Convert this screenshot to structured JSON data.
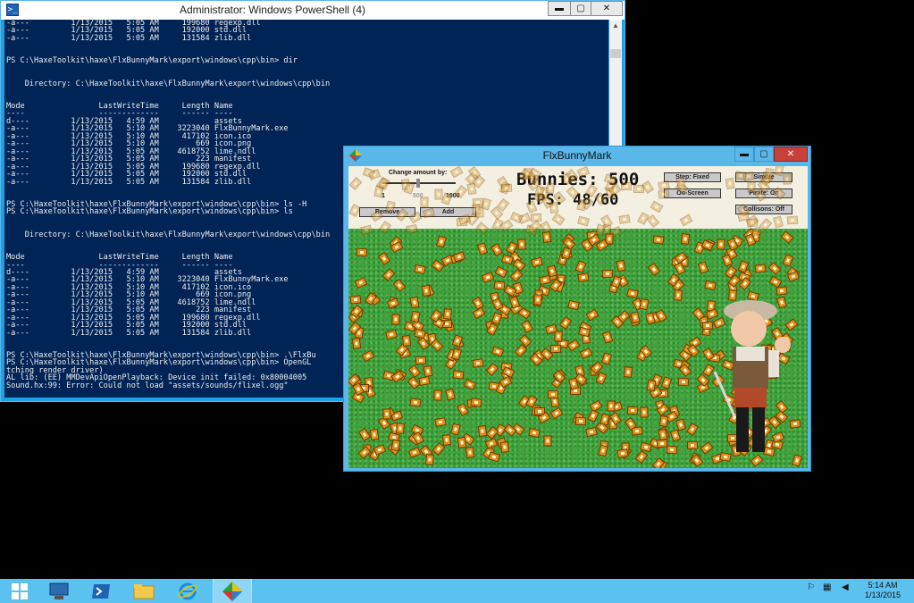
{
  "powershell": {
    "title": "Administrator: Windows PowerShell (4)",
    "min_label": "▬",
    "max_label": "▢",
    "close_label": "✕",
    "console_text": "-a---         1/13/2015   5:05 AM     199680 regexp.dll\n-a---         1/13/2015   5:05 AM     192000 std.dll\n-a---         1/13/2015   5:05 AM     131584 zlib.dll\n\n\nPS C:\\HaxeToolkit\\haxe\\FlxBunnyMark\\export\\windows\\cpp\\bin> dir\n\n\n    Directory: C:\\HaxeToolkit\\haxe\\FlxBunnyMark\\export\\windows\\cpp\\bin\n\n\nMode                LastWriteTime     Length Name\n----                -------------     ------ ----\nd----         1/13/2015   4:59 AM            assets\n-a---         1/13/2015   5:10 AM    3223040 FlxBunnyMark.exe\n-a---         1/13/2015   5:10 AM     417102 icon.ico\n-a---         1/13/2015   5:10 AM        669 icon.png\n-a---         1/13/2015   5:05 AM    4618752 lime.ndll\n-a---         1/13/2015   5:05 AM        223 manifest\n-a---         1/13/2015   5:05 AM     199680 regexp.dll\n-a---         1/13/2015   5:05 AM     192000 std.dll\n-a---         1/13/2015   5:05 AM     131584 zlib.dll\n\n\nPS C:\\HaxeToolkit\\haxe\\FlxBunnyMark\\export\\windows\\cpp\\bin> ls -H\nPS C:\\HaxeToolkit\\haxe\\FlxBunnyMark\\export\\windows\\cpp\\bin> ls\n\n\n    Directory: C:\\HaxeToolkit\\haxe\\FlxBunnyMark\\export\\windows\\cpp\\bin\n\n\nMode                LastWriteTime     Length Name\n----                -------------     ------ ----\nd----         1/13/2015   4:59 AM            assets\n-a---         1/13/2015   5:10 AM    3223040 FlxBunnyMark.exe\n-a---         1/13/2015   5:10 AM     417102 icon.ico\n-a---         1/13/2015   5:10 AM        669 icon.png\n-a---         1/13/2015   5:05 AM    4618752 lime.ndll\n-a---         1/13/2015   5:05 AM        223 manifest\n-a---         1/13/2015   5:05 AM     199680 regexp.dll\n-a---         1/13/2015   5:05 AM     192000 std.dll\n-a---         1/13/2015   5:05 AM     131584 zlib.dll\n\n\nPS C:\\HaxeToolkit\\haxe\\FlxBunnyMark\\export\\windows\\cpp\\bin> .\\FlxBu\nPS C:\\HaxeToolkit\\haxe\\FlxBunnyMark\\export\\windows\\cpp\\bin> OpenGL\ntching render driver)\nAL lib: (EE) MMDevApiOpenPlayback: Device init failed: 0x80004005\nSound.hx:99: Error: Could not load \"assets/sounds/flixel.ogg\"",
    "scroll_up_label": "▲"
  },
  "bunnymark": {
    "title": "FlxBunnyMark",
    "min_label": "▬",
    "max_label": "▢",
    "close_label": "✕",
    "change_amount_label": "Change amount by:",
    "slider_ticks": [
      "1",
      "500",
      "1000"
    ],
    "remove_label": "Remove",
    "add_label": "Add",
    "bunnies_text": "Bunnies: 500",
    "fps_text": "FPS: 48/60",
    "step_label": "Step: Fixed",
    "onscreen_label": "On-Screen",
    "simple_label": "Simple",
    "pirate_label": "Pirate: On",
    "collisions_label": "Collisons: Off",
    "bunny_count": 500
  },
  "taskbar": {
    "time": "5:14 AM",
    "date": "1/13/2015",
    "items": [
      "start",
      "server-manager",
      "powershell",
      "file-explorer",
      "internet-explorer",
      "flxbunnymark"
    ]
  },
  "colors": {
    "console_bg": "#012456",
    "console_fg": "#eeedf0",
    "taskbar": "#5bc1ef",
    "window_frame": "#5ab7ea"
  }
}
